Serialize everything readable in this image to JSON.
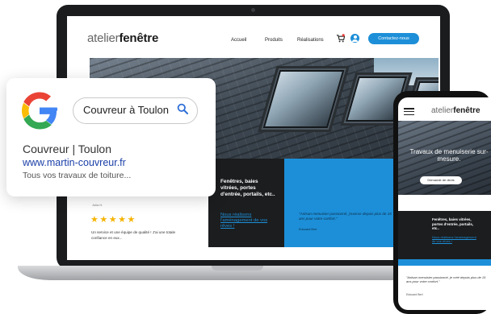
{
  "laptop_site": {
    "logo_prefix": "atelier",
    "logo_bold": "fenêtre",
    "nav": [
      "Accueil",
      "Produits",
      "Réalisations"
    ],
    "contact_button": "Contactez-nous",
    "review": {
      "author": "Julia H.",
      "stars": "★★★★★",
      "text": "Un service et une équipe de qualité ! J'ai une totale confiance en eux..."
    },
    "dark_block": {
      "text": "Fenêtres, baies vitrées, portes d'entrée, portails, etc..",
      "cta": "Nous réalisons l'aménagement de vos rêves !"
    },
    "quote": {
      "text": "\"Artisan menuisier passionné, j'exerce depuis plus de 15 ans pour votre confort.\"",
      "author": "Edouard Bert"
    }
  },
  "google_card": {
    "search_query": "Couvreur à Toulon",
    "result_title": "Couvreur | Toulon",
    "result_url": "www.martin-couvreur.fr",
    "result_desc": "Tous vos travaux de toiture..."
  },
  "phone_site": {
    "logo_prefix": "atelier",
    "logo_bold": "fenêtre",
    "hero_title": "Travaux de menuiserie sur-mesure.",
    "hero_button": "Demande de devis",
    "dark_text": "Fenêtres, baies vitrées, portes d'entrée, portails, etc..",
    "dark_cta": "Nous réalisons l'aménagement de vos rêves !",
    "quote_text": "\"Artisan menuisier passionné, je créé depuis plus de 15 ans pour votre confort.\"",
    "quote_author": "Edouard Bert"
  },
  "colors": {
    "accent_blue": "#1d8fd8",
    "dark": "#1b1d1f",
    "star": "#f5b301",
    "google_link": "#1a3fa8"
  }
}
